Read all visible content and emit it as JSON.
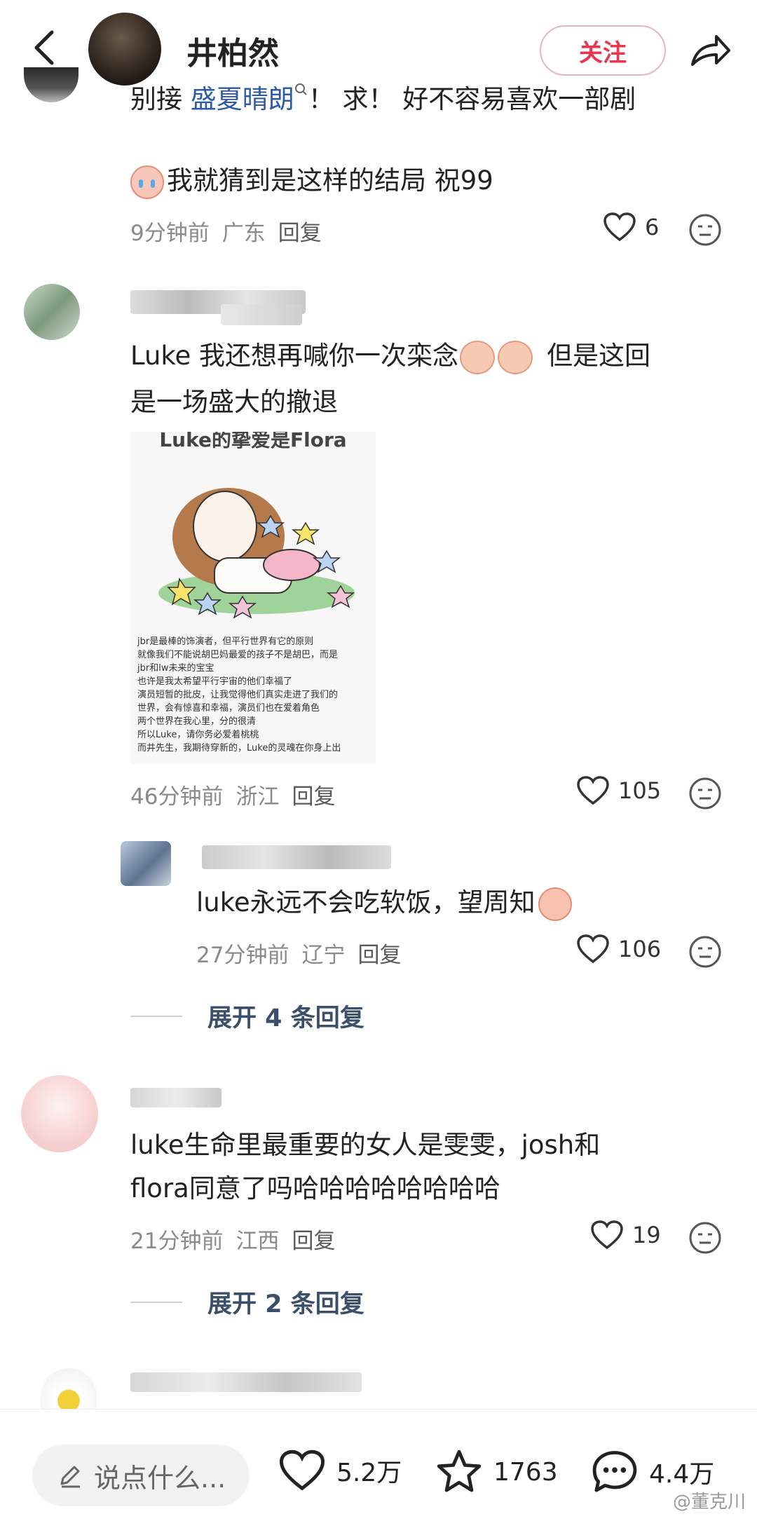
{
  "header": {
    "username": "井柏然",
    "follow_label": "关注"
  },
  "comments": [
    {
      "text_pre": "别接 ",
      "hashtag": "盛夏晴朗",
      "text_post": "！ 求！ 好不容易喜欢一部剧",
      "text_line2": "我就猜到是这样的结局 祝99",
      "time": "9分钟前",
      "location": "广东",
      "reply_label": "回复",
      "likes": "6"
    },
    {
      "text_line1": "Luke 我还想再喊你一次栾念",
      "text_line1_post": "但是这回",
      "text_line2": "是一场盛大的撤退",
      "card_title": "Luke的挚爱是Flora",
      "card_lines": [
        "jbr是最棒的饰演者，但平行世界有它的原则",
        "就像我们不能说胡巴妈最爱的孩子不是胡巴，而是",
        "jbr和lw未来的宝宝",
        "也许是我太希望平行宇宙的他们幸福了",
        "演员短暂的批皮，让我觉得他们真实走进了我们的",
        "世界，会有惊喜和幸福，演员们也在爱着角色",
        "两个世界在我心里，分的很清",
        "所以Luke，请你务必爱着桃桃",
        "而井先生，我期待穿新的，Luke的灵魂在你身上出"
      ],
      "time": "46分钟前",
      "location": "浙江",
      "reply_label": "回复",
      "likes": "105"
    },
    {
      "text": "luke永远不会吃软饭，望周知",
      "time": "27分钟前",
      "location": "辽宁",
      "reply_label": "回复",
      "likes": "106",
      "expand": "展开 4 条回复"
    },
    {
      "text_line1": "luke生命里最重要的女人是雯雯，josh和",
      "text_line2": "flora同意了吗哈哈哈哈哈哈哈哈",
      "time": "21分钟前",
      "location": "江西",
      "reply_label": "回复",
      "likes": "19",
      "expand": "展开 2 条回复"
    }
  ],
  "bottom_bar": {
    "input_placeholder": "说点什么...",
    "likes": "5.2万",
    "favorites": "1763",
    "comments": "4.4万"
  },
  "watermark": "@董克川",
  "colors": {
    "accent_red": "#e8374d",
    "hashtag_blue": "#2f5aa8",
    "meta_gray": "#8a8a8a"
  },
  "icons": [
    "back-arrow-icon",
    "share-icon",
    "search-mini-icon",
    "heart-icon",
    "dislike-face-icon",
    "pencil-icon",
    "star-icon",
    "comment-bubble-icon"
  ]
}
